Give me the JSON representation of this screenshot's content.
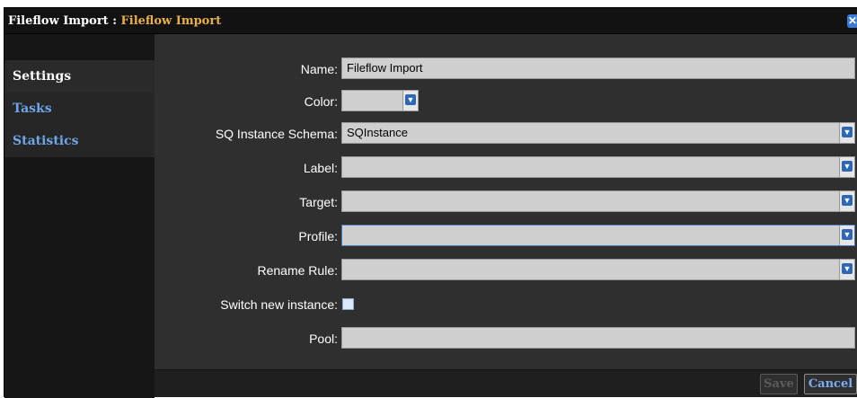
{
  "window": {
    "title_main": "Fileflow Import",
    "title_sep": " : ",
    "title_sub": "Fileflow Import",
    "close_glyph": "✕"
  },
  "sidebar": {
    "items": [
      {
        "label": "Settings",
        "active": true
      },
      {
        "label": "Tasks",
        "active": false
      },
      {
        "label": "Statistics",
        "active": false
      }
    ]
  },
  "form": {
    "name_label": "Name:",
    "name_value": "Fileflow Import",
    "color_label": "Color:",
    "color_value": "",
    "schema_label": "SQ Instance Schema:",
    "schema_value": "SQInstance",
    "label_label": "Label:",
    "label_value": "",
    "target_label": "Target:",
    "target_value": "",
    "profile_label": "Profile:",
    "profile_value": "",
    "rename_label": "Rename Rule:",
    "rename_value": "",
    "switch_label": "Switch new instance:",
    "switch_checked": false,
    "pool_label": "Pool:",
    "pool_value": ""
  },
  "footer": {
    "save_label": "Save",
    "cancel_label": "Cancel"
  },
  "icons": {
    "dropdown": "chevron-down-icon",
    "close": "close-icon"
  },
  "colors": {
    "title_accent": "#e8b04c",
    "link": "#6fa6e8",
    "dropdown_chevron": "#2e67b5"
  }
}
